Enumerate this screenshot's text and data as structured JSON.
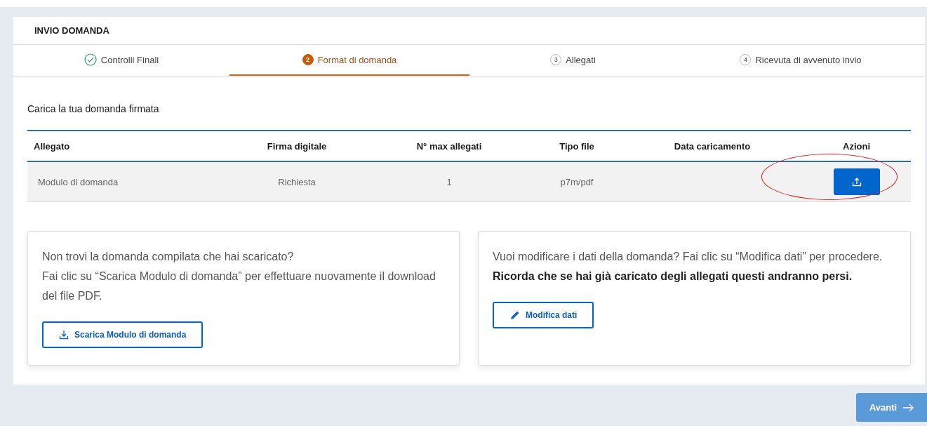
{
  "panel": {
    "title": "INVIO DOMANDA"
  },
  "steps": [
    {
      "label": "Controlli Finali",
      "completed": true,
      "selected": false
    },
    {
      "number": "2",
      "label": "Format di domanda",
      "completed": false,
      "selected": true
    },
    {
      "number": "3",
      "label": "Allegati",
      "completed": false,
      "selected": false
    },
    {
      "number": "4",
      "label": "Ricevuta di avvenuto invio",
      "completed": false,
      "selected": false
    }
  ],
  "section_title": "Carica la tua domanda firmata",
  "table": {
    "columns": [
      "Allegato",
      "Firma digitale",
      "N° max allegati",
      "Tipo file",
      "Data caricamento",
      "Azioni"
    ],
    "rows": [
      {
        "cells": [
          "Modulo di domanda",
          "Richiesta",
          "1",
          "p7m/pdf"
        ],
        "highlighted": true
      }
    ]
  },
  "cards": [
    {
      "paragraphs": [
        {
          "text": "Non trovi la domanda compilata che hai scaricato?\nFai clic su “Scarica Modulo di domanda” per effettuare nuovamente il download del file PDF.",
          "bold": false
        }
      ],
      "button": {
        "label": "Scarica Modulo di domanda",
        "kind": "download"
      }
    },
    {
      "paragraphs": [
        {
          "text": "Vuoi modificare i dati della domanda? Fai clic su “Modifica dati” per procedere.",
          "bold": false
        },
        {
          "text": "Ricorda che se hai già caricato degli allegati questi andranno persi.",
          "bold": true
        }
      ],
      "button": {
        "label": "Modifica dati",
        "kind": "edit"
      }
    }
  ],
  "next_button": {
    "label": "Avanti",
    "disabled": true
  }
}
